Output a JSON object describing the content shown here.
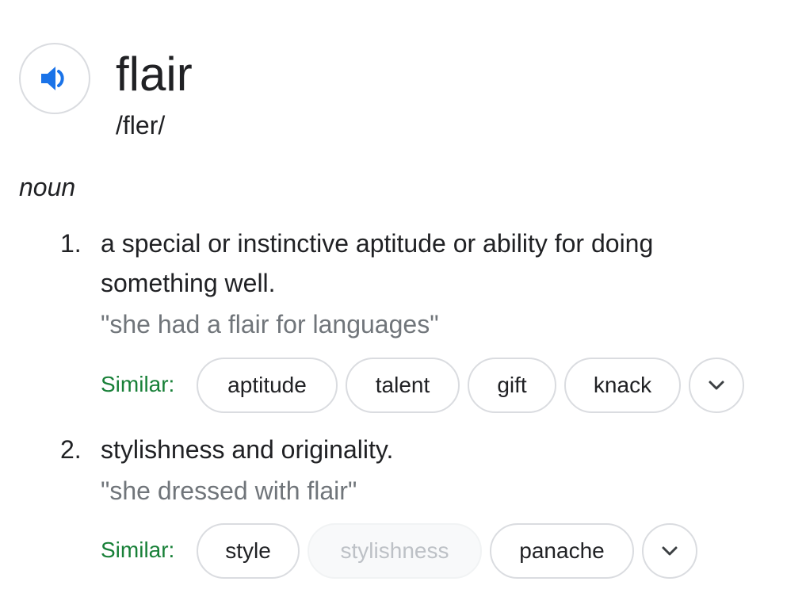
{
  "entry": {
    "word": "flair",
    "phonetic": "/fler/",
    "part_of_speech": "noun",
    "speaker_icon": "speaker-icon",
    "accent_color": "#1a73e8"
  },
  "senses": [
    {
      "number": "1.",
      "definition": "a special or instinctive aptitude or ability for doing something well.",
      "example": "\"she had a flair for languages\"",
      "similar_label": "Similar:",
      "similar": [
        "aptitude",
        "talent",
        "gift",
        "knack"
      ],
      "expand_icon": "chevron-down-icon"
    },
    {
      "number": "2.",
      "definition": "stylishness and originality.",
      "example": "\"she dressed with flair\"",
      "similar_label": "Similar:",
      "similar": [
        "style",
        "stylishness",
        "panache"
      ],
      "expand_icon": "chevron-down-icon"
    }
  ],
  "colors": {
    "similar_label": "#188038",
    "example_text": "#70757a",
    "chip_border": "#dadce0"
  }
}
